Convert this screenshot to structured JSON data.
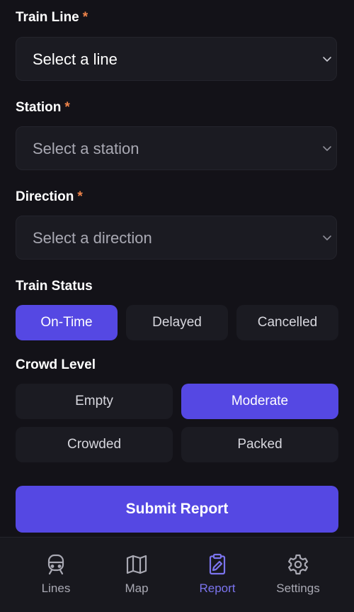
{
  "form": {
    "train_line": {
      "label": "Train Line",
      "required_mark": "*",
      "value": "Select a line"
    },
    "station": {
      "label": "Station",
      "required_mark": "*",
      "value": "Select a station"
    },
    "direction": {
      "label": "Direction",
      "required_mark": "*",
      "value": "Select a direction"
    },
    "train_status": {
      "label": "Train Status",
      "options": [
        "On-Time",
        "Delayed",
        "Cancelled"
      ],
      "selected": "On-Time"
    },
    "crowd_level": {
      "label": "Crowd Level",
      "options": [
        "Empty",
        "Moderate",
        "Crowded",
        "Packed"
      ],
      "selected": "Moderate"
    },
    "submit_label": "Submit Report"
  },
  "nav": {
    "items": [
      {
        "label": "Lines",
        "icon": "train-icon"
      },
      {
        "label": "Map",
        "icon": "map-icon"
      },
      {
        "label": "Report",
        "icon": "clipboard-edit-icon"
      },
      {
        "label": "Settings",
        "icon": "gear-icon"
      }
    ],
    "active": "Report"
  },
  "colors": {
    "background": "#131218",
    "surface": "#1b1b22",
    "accent": "#5548e3",
    "accent_text": "#7b74ee",
    "required": "#f0844a",
    "muted_text": "#a9a9b3"
  }
}
